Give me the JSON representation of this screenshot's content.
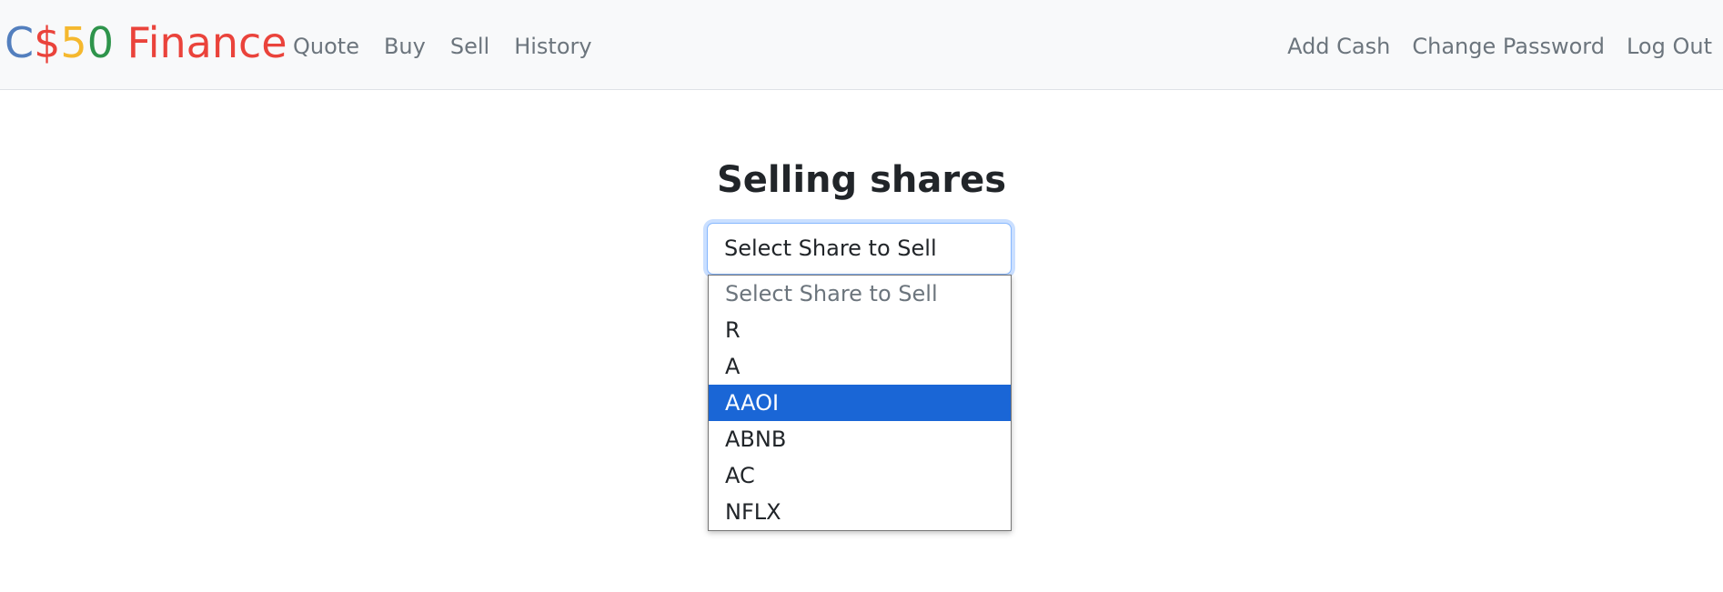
{
  "navbar": {
    "brand": {
      "parts": [
        {
          "text": "C",
          "color": "#537fbe"
        },
        {
          "text": "$",
          "color": "#ea433b"
        },
        {
          "text": "5",
          "color": "#f5b82e"
        },
        {
          "text": "0",
          "color": "#2e944b"
        },
        {
          "text": " Finance",
          "color": "#ea433b"
        }
      ]
    },
    "left_links": [
      "Quote",
      "Buy",
      "Sell",
      "History"
    ],
    "right_links": [
      "Add Cash",
      "Change Password",
      "Log Out"
    ]
  },
  "main": {
    "title": "Selling shares",
    "select": {
      "current_value": "Select Share to Sell",
      "options": [
        "Select Share to Sell",
        "R",
        "A",
        "AAOI",
        "ABNB",
        "AC",
        "NFLX"
      ],
      "highlighted": "AAOI",
      "placeholder_option": "Select Share to Sell"
    }
  },
  "colors": {
    "accent": "#1a66d6",
    "navbar_bg": "#f8f9fa",
    "link": "#6c757d"
  }
}
